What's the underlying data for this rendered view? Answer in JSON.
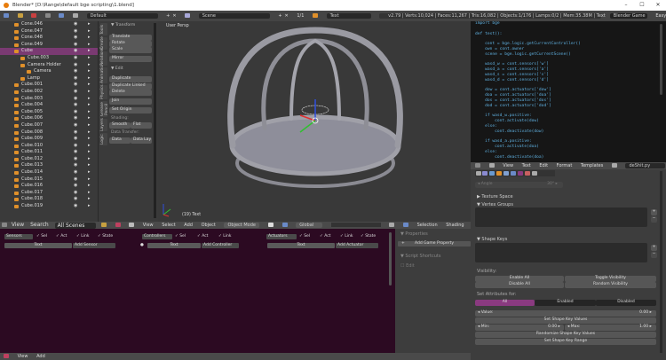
{
  "window": {
    "title": "Blender* [D:\\Range\\default bge scripting\\1.blend]",
    "minimize": "–",
    "maximize": "☐",
    "close": "✕"
  },
  "info_header": {
    "screen": "Default",
    "scene": "Scene",
    "layer": "1/1",
    "text": "Text",
    "stats": "v2.79 | Verts:10,024 | Faces:11,267 | Tris:16,082 | Objects:1/176 | Lamps:0/2 | Mem:35.38M | Text",
    "engine": "Blender Game",
    "addon": "Easy Logging"
  },
  "outliner": {
    "items": [
      {
        "label": "Cone.046",
        "indent": 0
      },
      {
        "label": "Cone.047",
        "indent": 0
      },
      {
        "label": "Cone.048",
        "indent": 0
      },
      {
        "label": "Cone.049",
        "indent": 0
      },
      {
        "label": "Cube",
        "indent": 0,
        "selected": true
      },
      {
        "label": "Cube.003",
        "indent": 1
      },
      {
        "label": "Camera Holder",
        "indent": 1
      },
      {
        "label": "Camera",
        "indent": 2
      },
      {
        "label": "Lamp",
        "indent": 1
      },
      {
        "label": "Cube.001",
        "indent": 0
      },
      {
        "label": "Cube.002",
        "indent": 0
      },
      {
        "label": "Cube.003",
        "indent": 0
      },
      {
        "label": "Cube.004",
        "indent": 0
      },
      {
        "label": "Cube.005",
        "indent": 0
      },
      {
        "label": "Cube.006",
        "indent": 0
      },
      {
        "label": "Cube.007",
        "indent": 0
      },
      {
        "label": "Cube.008",
        "indent": 0
      },
      {
        "label": "Cube.009",
        "indent": 0
      },
      {
        "label": "Cube.010",
        "indent": 0
      },
      {
        "label": "Cube.011",
        "indent": 0
      },
      {
        "label": "Cube.012",
        "indent": 0
      },
      {
        "label": "Cube.013",
        "indent": 0
      },
      {
        "label": "Cube.014",
        "indent": 0
      },
      {
        "label": "Cube.015",
        "indent": 0
      },
      {
        "label": "Cube.016",
        "indent": 0
      },
      {
        "label": "Cube.017",
        "indent": 0
      },
      {
        "label": "Cube.018",
        "indent": 0
      },
      {
        "label": "Cube.019",
        "indent": 0
      }
    ],
    "header": {
      "view": "View",
      "search": "Search",
      "filter": "All Scenes"
    }
  },
  "toolshelf": {
    "tabs": [
      "Tools",
      "Create",
      "Relations",
      "Animation",
      "Physics",
      "Grease Pencil",
      "Layers",
      "Logic"
    ],
    "transform_header": "▼ Transform",
    "translate": "Translate",
    "rotate": "Rotate",
    "scale": "Scale",
    "mirror": "Mirror",
    "edit_header": "▼ Edit",
    "duplicate": "Duplicate",
    "duplicate_linked": "Duplicate Linked",
    "delete": "Delete",
    "join": "Join",
    "set_origin": "Set Origin",
    "shading_label": "Shading:",
    "smooth": "Smooth",
    "flat": "Flat",
    "data_transfer_label": "Data Transfer:",
    "data": "Data",
    "data_lay": "Data Lay"
  },
  "viewport": {
    "view_name": "User Persp",
    "object_info": "(19) Text",
    "header": {
      "view": "View",
      "select": "Select",
      "add": "Add",
      "object": "Object",
      "mode": "Object Mode",
      "orientation": "Global",
      "selection": "Selection",
      "shading": "Shading",
      "tools": "To"
    }
  },
  "text_editor": {
    "lines": [
      "import bge",
      "",
      "def test():",
      "",
      "    cont = bge.logic.getCurrentController()",
      "    own = cont.owner",
      "    scene = bge.logic.getCurrentScene()",
      "",
      "    wasd_w = cont.sensors['w']",
      "    wasd_a = cont.sensors['a']",
      "    wasd_s = cont.sensors['s']",
      "    wasd_d = cont.sensors['d']",
      "",
      "    dow = cont.actuators['dow']",
      "    doa = cont.actuators['doa']",
      "    dos = cont.actuators['dos']",
      "    dod = cont.actuators['dod']",
      "",
      "    if wasd_w.positive:",
      "        cont.activate(dow)",
      "    else:",
      "        cont.deactivate(dow)",
      "",
      "    if wasd_a.positive:",
      "        cont.activate(doa)",
      "    else:",
      "        cont.deactivate(doa)"
    ],
    "header": {
      "view": "View",
      "text": "Text",
      "edit": "Edit",
      "format": "Format",
      "templates": "Templates",
      "filename": "deShit.py"
    }
  },
  "properties": {
    "angle_label": "◂ Angle",
    "angle_value": "30° ▸",
    "texture_space": "▶ Texture Space",
    "vertex_groups": "▼ Vertex Groups",
    "shape_keys": "▼ Shape Keys",
    "visibility_label": "Visibility:",
    "enable_all": "Enable All",
    "toggle_visibility": "Toggle Visibility",
    "disable_all": "Disable All",
    "random_visibility": "Random Visibility",
    "set_attributes_label": "Set Attributes for:",
    "filter_all": "All",
    "filter_enabled": "Enabled",
    "filter_disabled": "Disabled",
    "value_label": "◂ Value:",
    "value": "0.00 ▸",
    "set_values": "Set Shape Key Values",
    "min_label": "◂ Min:",
    "min_value": "0.00 ▸",
    "max_label": "◂ Max:",
    "max_value": "1.00 ▸",
    "randomize": "Randomize Shape Key Values",
    "set_range": "Set Shape Key Range",
    "list_plus": "+",
    "list_minus": "−"
  },
  "logic": {
    "sensors": {
      "title": "Sensors",
      "object": "Text",
      "add": "Add Sensor"
    },
    "controllers": {
      "title": "Controllers",
      "object": "Text",
      "add": "Add Controller"
    },
    "actuators": {
      "title": "Actuators",
      "object": "Text",
      "add": "Add Actuator"
    },
    "sel": "Sel",
    "act": "Act",
    "link": "Link",
    "state": "State",
    "side": {
      "properties": "▼ Properties",
      "add_property": "Add Game Property",
      "plus": "+",
      "script_shortcuts": "▼ Script Shortcuts",
      "edit": "Edit"
    },
    "footer": {
      "view": "View",
      "add": "Add"
    }
  },
  "colors": {
    "selection": "#7a3a72",
    "logic_bg": "#2c0a22",
    "code": "#5fb0e0",
    "accent_button": "#8a3a80"
  }
}
